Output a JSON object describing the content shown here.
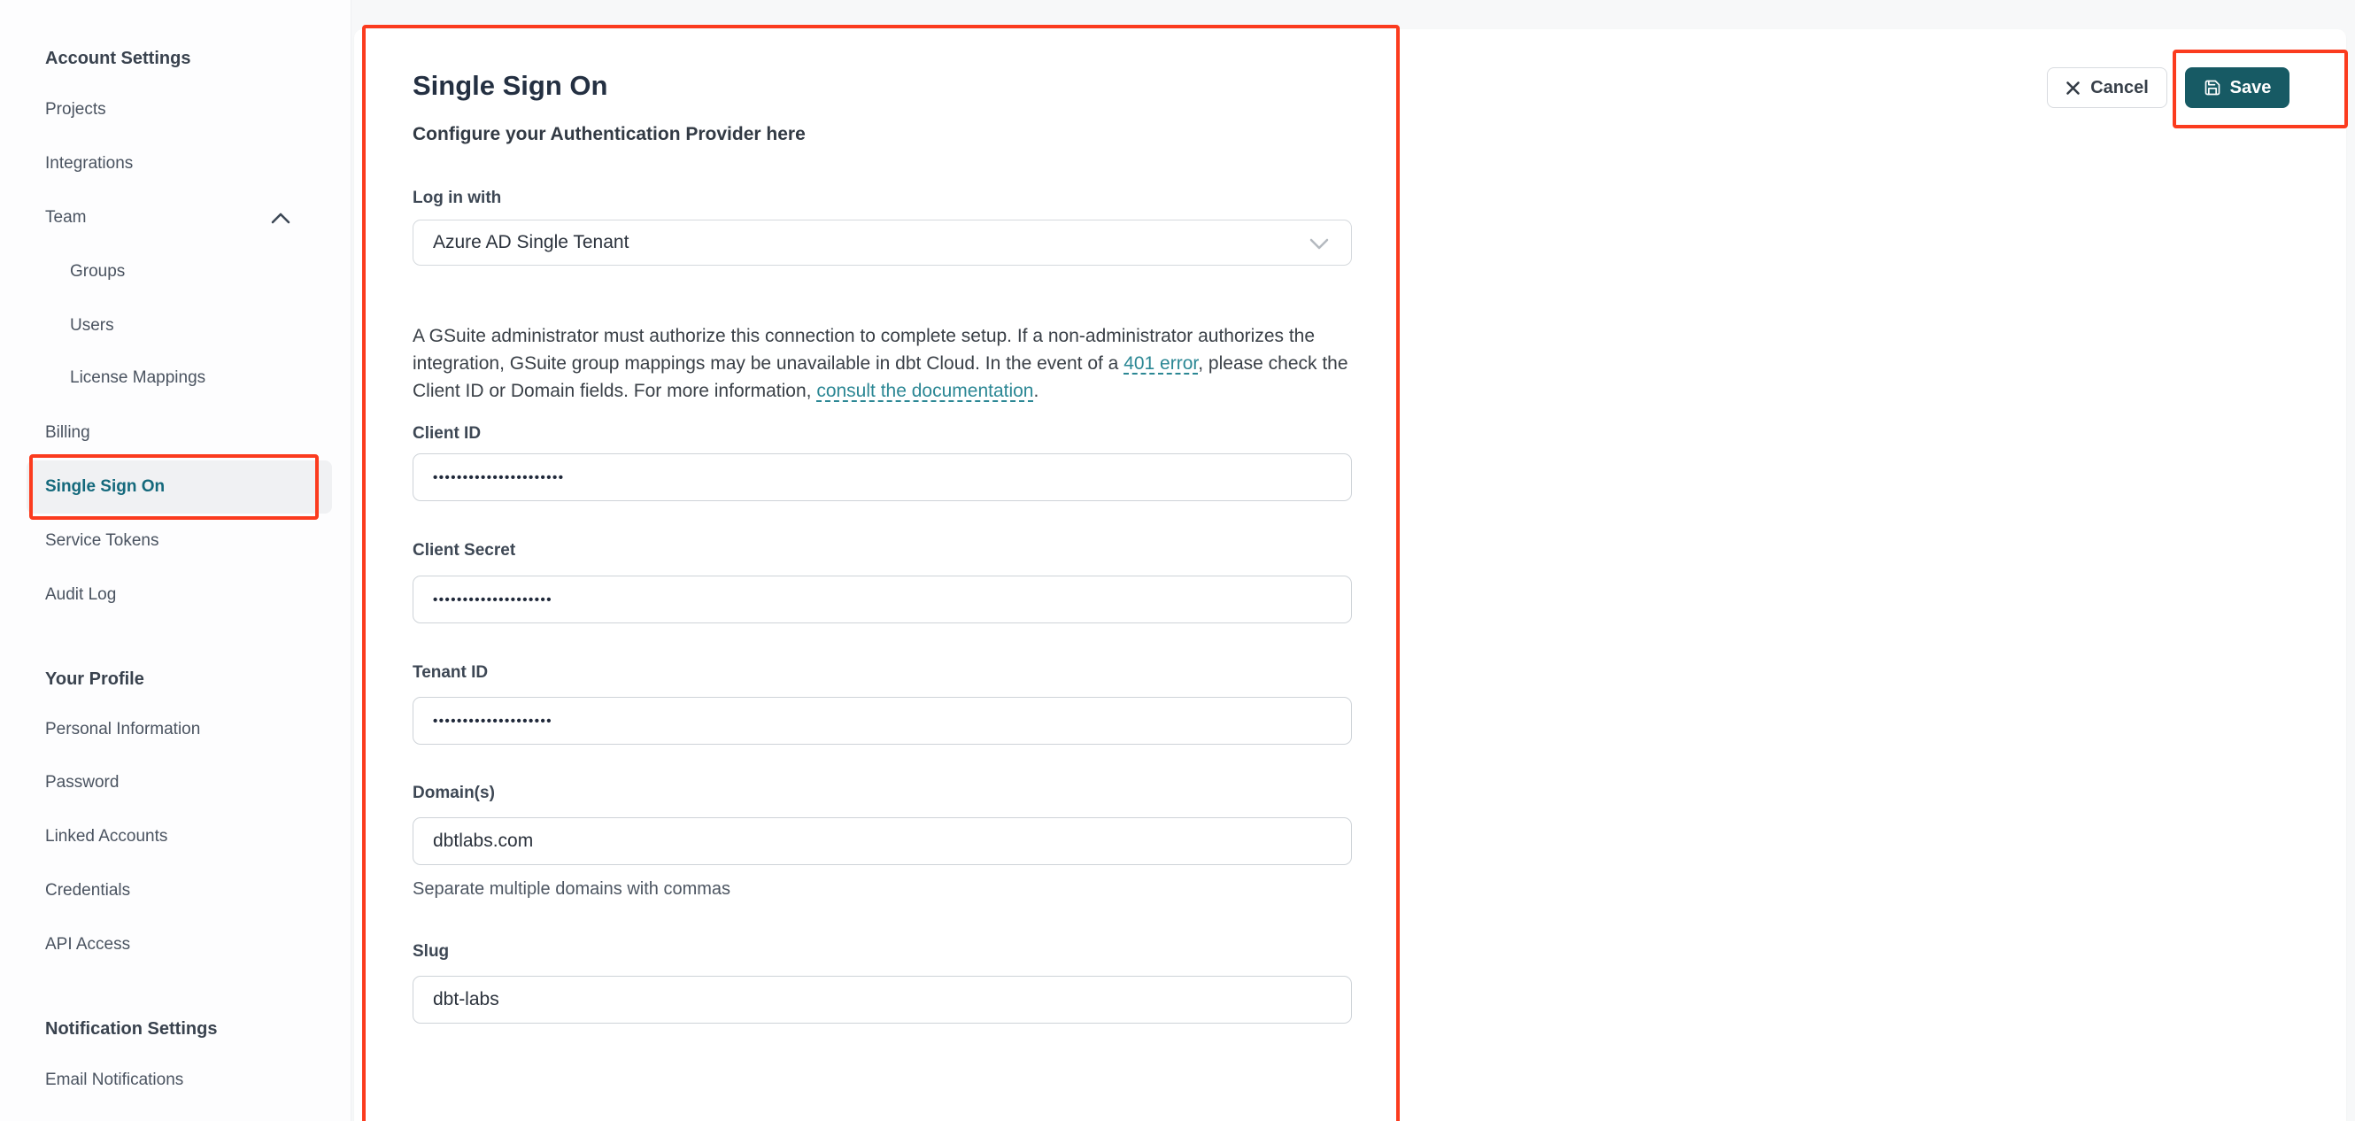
{
  "colors": {
    "annotation_red": "#fb3b1e",
    "active_teal": "#14697c",
    "save_button_teal": "#175a64",
    "link_teal": "#2b8794"
  },
  "sidebar": {
    "account_settings_title": "Account Settings",
    "projects": "Projects",
    "integrations": "Integrations",
    "team": "Team",
    "groups": "Groups",
    "users": "Users",
    "license_mappings": "License Mappings",
    "billing": "Billing",
    "single_sign_on": "Single Sign On",
    "service_tokens": "Service Tokens",
    "audit_log": "Audit Log",
    "your_profile_title": "Your Profile",
    "personal_information": "Personal Information",
    "password": "Password",
    "linked_accounts": "Linked Accounts",
    "credentials": "Credentials",
    "api_access": "API Access",
    "notification_settings_title": "Notification Settings",
    "email_notifications": "Email Notifications"
  },
  "header": {
    "cancel_label": "Cancel",
    "save_label": "Save"
  },
  "main": {
    "title": "Single Sign On",
    "subtitle": "Configure your Authentication Provider here",
    "login_with": {
      "label": "Log in with",
      "value": "Azure AD Single Tenant"
    },
    "notice": {
      "part1": "A GSuite administrator must authorize this connection to complete setup. If a non-administrator authorizes the integration, GSuite group mappings may be unavailable in dbt Cloud. In the event of a ",
      "link1": "401 error",
      "part2": ", please check the Client ID or Domain fields. For more information, ",
      "link2": "consult the documentation",
      "part3": "."
    },
    "fields": {
      "client_id": {
        "label": "Client ID",
        "value": "••••••••••••••••••••••"
      },
      "client_secret": {
        "label": "Client Secret",
        "value": "••••••••••••••••••••"
      },
      "tenant_id": {
        "label": "Tenant ID",
        "value": "••••••••••••••••••••"
      },
      "domains": {
        "label": "Domain(s)",
        "value": "dbtlabs.com",
        "helper": "Separate multiple domains with commas"
      },
      "slug": {
        "label": "Slug",
        "value": "dbt-labs"
      }
    }
  }
}
